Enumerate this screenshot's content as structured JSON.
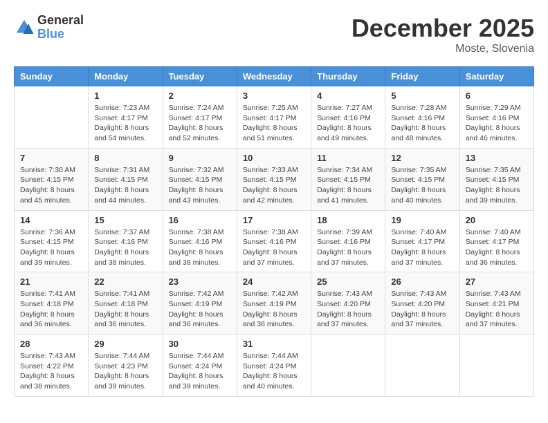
{
  "logo": {
    "general": "General",
    "blue": "Blue"
  },
  "title": "December 2025",
  "location": "Moste, Slovenia",
  "days_of_week": [
    "Sunday",
    "Monday",
    "Tuesday",
    "Wednesday",
    "Thursday",
    "Friday",
    "Saturday"
  ],
  "weeks": [
    [
      {
        "day": "",
        "info": ""
      },
      {
        "day": "1",
        "info": "Sunrise: 7:23 AM\nSunset: 4:17 PM\nDaylight: 8 hours\nand 54 minutes."
      },
      {
        "day": "2",
        "info": "Sunrise: 7:24 AM\nSunset: 4:17 PM\nDaylight: 8 hours\nand 52 minutes."
      },
      {
        "day": "3",
        "info": "Sunrise: 7:25 AM\nSunset: 4:17 PM\nDaylight: 8 hours\nand 51 minutes."
      },
      {
        "day": "4",
        "info": "Sunrise: 7:27 AM\nSunset: 4:16 PM\nDaylight: 8 hours\nand 49 minutes."
      },
      {
        "day": "5",
        "info": "Sunrise: 7:28 AM\nSunset: 4:16 PM\nDaylight: 8 hours\nand 48 minutes."
      },
      {
        "day": "6",
        "info": "Sunrise: 7:29 AM\nSunset: 4:16 PM\nDaylight: 8 hours\nand 46 minutes."
      }
    ],
    [
      {
        "day": "7",
        "info": "Sunrise: 7:30 AM\nSunset: 4:15 PM\nDaylight: 8 hours\nand 45 minutes."
      },
      {
        "day": "8",
        "info": "Sunrise: 7:31 AM\nSunset: 4:15 PM\nDaylight: 8 hours\nand 44 minutes."
      },
      {
        "day": "9",
        "info": "Sunrise: 7:32 AM\nSunset: 4:15 PM\nDaylight: 8 hours\nand 43 minutes."
      },
      {
        "day": "10",
        "info": "Sunrise: 7:33 AM\nSunset: 4:15 PM\nDaylight: 8 hours\nand 42 minutes."
      },
      {
        "day": "11",
        "info": "Sunrise: 7:34 AM\nSunset: 4:15 PM\nDaylight: 8 hours\nand 41 minutes."
      },
      {
        "day": "12",
        "info": "Sunrise: 7:35 AM\nSunset: 4:15 PM\nDaylight: 8 hours\nand 40 minutes."
      },
      {
        "day": "13",
        "info": "Sunrise: 7:35 AM\nSunset: 4:15 PM\nDaylight: 8 hours\nand 39 minutes."
      }
    ],
    [
      {
        "day": "14",
        "info": "Sunrise: 7:36 AM\nSunset: 4:15 PM\nDaylight: 8 hours\nand 39 minutes."
      },
      {
        "day": "15",
        "info": "Sunrise: 7:37 AM\nSunset: 4:16 PM\nDaylight: 8 hours\nand 38 minutes."
      },
      {
        "day": "16",
        "info": "Sunrise: 7:38 AM\nSunset: 4:16 PM\nDaylight: 8 hours\nand 38 minutes."
      },
      {
        "day": "17",
        "info": "Sunrise: 7:38 AM\nSunset: 4:16 PM\nDaylight: 8 hours\nand 37 minutes."
      },
      {
        "day": "18",
        "info": "Sunrise: 7:39 AM\nSunset: 4:16 PM\nDaylight: 8 hours\nand 37 minutes."
      },
      {
        "day": "19",
        "info": "Sunrise: 7:40 AM\nSunset: 4:17 PM\nDaylight: 8 hours\nand 37 minutes."
      },
      {
        "day": "20",
        "info": "Sunrise: 7:40 AM\nSunset: 4:17 PM\nDaylight: 8 hours\nand 36 minutes."
      }
    ],
    [
      {
        "day": "21",
        "info": "Sunrise: 7:41 AM\nSunset: 4:18 PM\nDaylight: 8 hours\nand 36 minutes."
      },
      {
        "day": "22",
        "info": "Sunrise: 7:41 AM\nSunset: 4:18 PM\nDaylight: 8 hours\nand 36 minutes."
      },
      {
        "day": "23",
        "info": "Sunrise: 7:42 AM\nSunset: 4:19 PM\nDaylight: 8 hours\nand 36 minutes."
      },
      {
        "day": "24",
        "info": "Sunrise: 7:42 AM\nSunset: 4:19 PM\nDaylight: 8 hours\nand 36 minutes."
      },
      {
        "day": "25",
        "info": "Sunrise: 7:43 AM\nSunset: 4:20 PM\nDaylight: 8 hours\nand 37 minutes."
      },
      {
        "day": "26",
        "info": "Sunrise: 7:43 AM\nSunset: 4:20 PM\nDaylight: 8 hours\nand 37 minutes."
      },
      {
        "day": "27",
        "info": "Sunrise: 7:43 AM\nSunset: 4:21 PM\nDaylight: 8 hours\nand 37 minutes."
      }
    ],
    [
      {
        "day": "28",
        "info": "Sunrise: 7:43 AM\nSunset: 4:22 PM\nDaylight: 8 hours\nand 38 minutes."
      },
      {
        "day": "29",
        "info": "Sunrise: 7:44 AM\nSunset: 4:23 PM\nDaylight: 8 hours\nand 39 minutes."
      },
      {
        "day": "30",
        "info": "Sunrise: 7:44 AM\nSunset: 4:24 PM\nDaylight: 8 hours\nand 39 minutes."
      },
      {
        "day": "31",
        "info": "Sunrise: 7:44 AM\nSunset: 4:24 PM\nDaylight: 8 hours\nand 40 minutes."
      },
      {
        "day": "",
        "info": ""
      },
      {
        "day": "",
        "info": ""
      },
      {
        "day": "",
        "info": ""
      }
    ]
  ]
}
